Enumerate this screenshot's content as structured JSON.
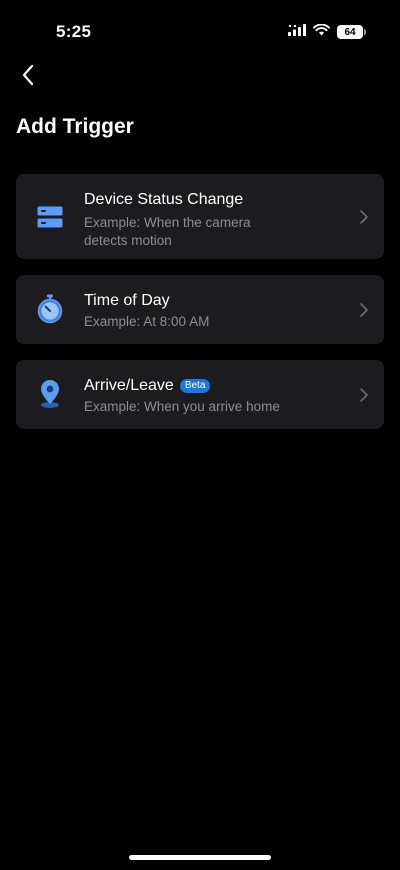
{
  "status_bar": {
    "time": "5:25",
    "battery": "64"
  },
  "header": {
    "back_icon": "chevron-left-icon",
    "title": "Add Trigger"
  },
  "colors": {
    "background": "#000000",
    "card": "#1c1c1e",
    "secondary_text": "#8e8e93",
    "accent_blue": "#1778e4",
    "icon_blue": "#5a9cf8"
  },
  "triggers": [
    {
      "icon": "device-status-icon",
      "title": "Device Status Change",
      "subtitle": "Example: When the camera detects motion"
    },
    {
      "icon": "stopwatch-icon",
      "title": "Time of Day",
      "subtitle": "Example: At 8:00 AM"
    },
    {
      "icon": "location-pin-icon",
      "title": "Arrive/Leave",
      "badge": "Beta",
      "subtitle": "Example: When you arrive home"
    }
  ]
}
